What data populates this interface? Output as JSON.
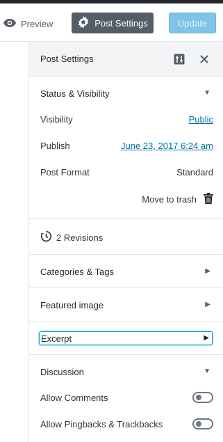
{
  "topbar": {
    "preview_label": "Preview",
    "settings_label": "Post Settings",
    "update_label": "Update"
  },
  "panel": {
    "title": "Post Settings",
    "status": {
      "title": "Status & Visibility",
      "visibility_label": "Visibility",
      "visibility_value": "Public",
      "publish_label": "Publish",
      "publish_value": "June 23, 2017 6:24 am",
      "format_label": "Post Format",
      "format_value": "Standard",
      "trash_label": "Move to trash"
    },
    "revisions_label": "2 Revisions",
    "categories_label": "Categories & Tags",
    "featured_label": "Featured image",
    "excerpt_label": "Excerpt",
    "discussion": {
      "title": "Discussion",
      "comments_label": "Allow Comments",
      "pingbacks_label": "Allow Pingbacks & Trackbacks"
    }
  },
  "colors": {
    "primary": "#0073aa",
    "settings_button": "#555d66",
    "update_button": "#7fc4e6"
  }
}
